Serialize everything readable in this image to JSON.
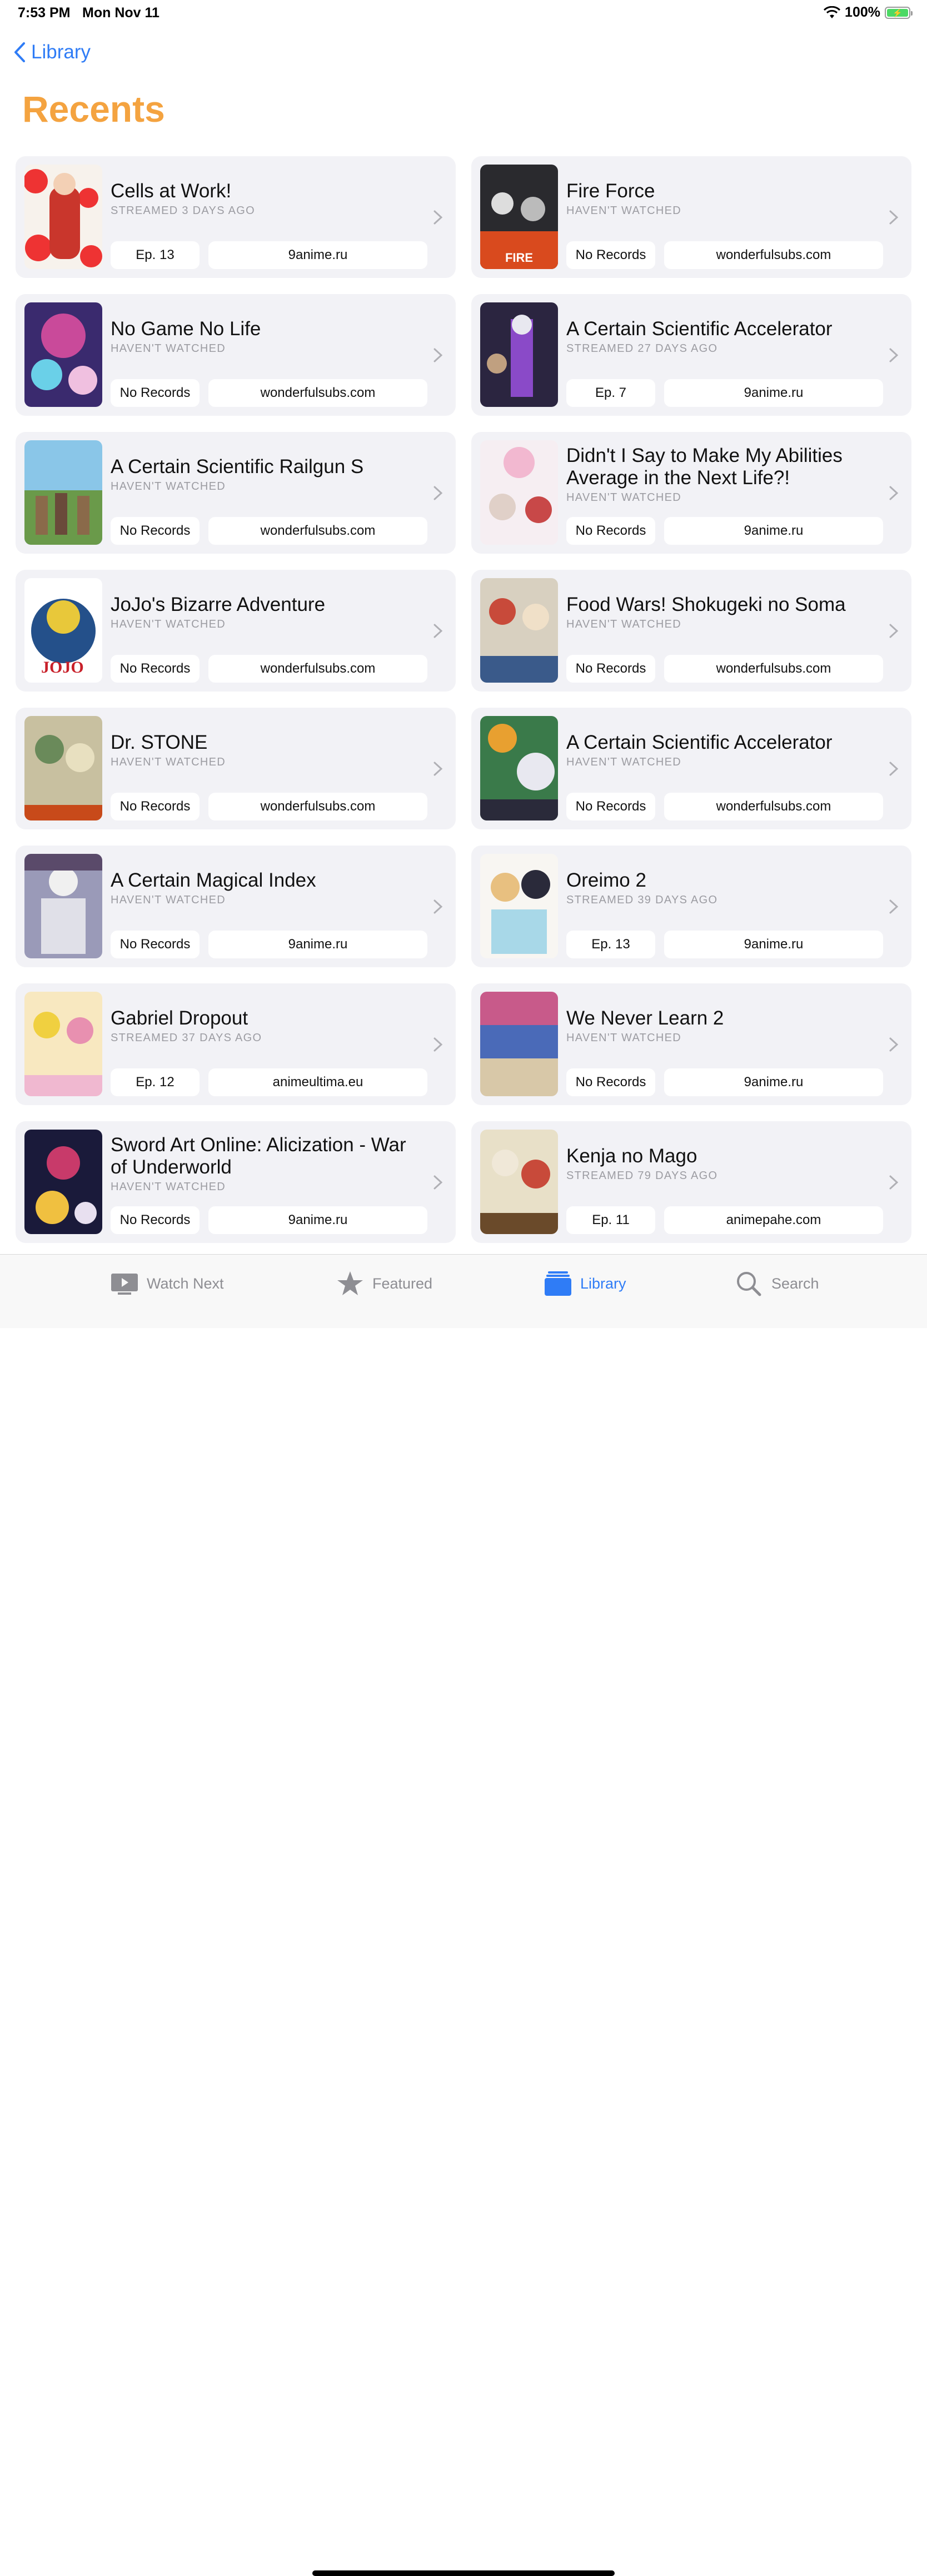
{
  "status_bar": {
    "time": "7:53 PM",
    "date": "Mon Nov 11",
    "battery": "100%"
  },
  "nav": {
    "back_label": "Library"
  },
  "page": {
    "title": "Recents"
  },
  "colors": {
    "accent": "#2f7cf6",
    "title": "#f4a340",
    "card": "#f2f2f6"
  },
  "cards": [
    {
      "title": "Cells at Work!",
      "status": "STREAMED 3 DAYS AGO",
      "episode": "Ep. 13",
      "source": "9anime.ru"
    },
    {
      "title": "Fire Force",
      "status": "HAVEN'T WATCHED",
      "episode": "No Records",
      "source": "wonderfulsubs.com"
    },
    {
      "title": "No Game No Life",
      "status": "HAVEN'T WATCHED",
      "episode": "No Records",
      "source": "wonderfulsubs.com"
    },
    {
      "title": "A Certain Scientific Accelerator",
      "status": "STREAMED 27 DAYS AGO",
      "episode": "Ep. 7",
      "source": "9anime.ru"
    },
    {
      "title": "A Certain Scientific Railgun S",
      "status": "HAVEN'T WATCHED",
      "episode": "No Records",
      "source": "wonderfulsubs.com"
    },
    {
      "title": "Didn't I Say to Make My Abilities Average in the Next Life?!",
      "status": "HAVEN'T WATCHED",
      "episode": "No Records",
      "source": "9anime.ru"
    },
    {
      "title": "JoJo's Bizarre Adventure",
      "status": "HAVEN'T WATCHED",
      "episode": "No Records",
      "source": "wonderfulsubs.com"
    },
    {
      "title": "Food Wars! Shokugeki no Soma",
      "status": "HAVEN'T WATCHED",
      "episode": "No Records",
      "source": "wonderfulsubs.com"
    },
    {
      "title": "Dr. STONE",
      "status": "HAVEN'T WATCHED",
      "episode": "No Records",
      "source": "wonderfulsubs.com"
    },
    {
      "title": "A Certain Scientific Accelerator",
      "status": "HAVEN'T WATCHED",
      "episode": "No Records",
      "source": "wonderfulsubs.com"
    },
    {
      "title": "A Certain Magical Index",
      "status": "HAVEN'T WATCHED",
      "episode": "No Records",
      "source": "9anime.ru"
    },
    {
      "title": "Oreimo 2",
      "status": "STREAMED 39 DAYS AGO",
      "episode": "Ep. 13",
      "source": "9anime.ru"
    },
    {
      "title": "Gabriel Dropout",
      "status": "STREAMED 37 DAYS AGO",
      "episode": "Ep. 12",
      "source": "animeultima.eu"
    },
    {
      "title": "We Never Learn 2",
      "status": "HAVEN'T WATCHED",
      "episode": "No Records",
      "source": "9anime.ru"
    },
    {
      "title": "Sword Art Online: Alicization - War of Underworld",
      "status": "HAVEN'T WATCHED",
      "episode": "No Records",
      "source": "9anime.ru"
    },
    {
      "title": "Kenja no Mago",
      "status": "STREAMED 79 DAYS AGO",
      "episode": "Ep. 11",
      "source": "animepahe.com"
    }
  ],
  "tabs": [
    {
      "label": "Watch Next",
      "icon": "play-screen-icon",
      "active": false
    },
    {
      "label": "Featured",
      "icon": "star-icon",
      "active": false
    },
    {
      "label": "Library",
      "icon": "library-stack-icon",
      "active": true
    },
    {
      "label": "Search",
      "icon": "search-icon",
      "active": false
    }
  ]
}
